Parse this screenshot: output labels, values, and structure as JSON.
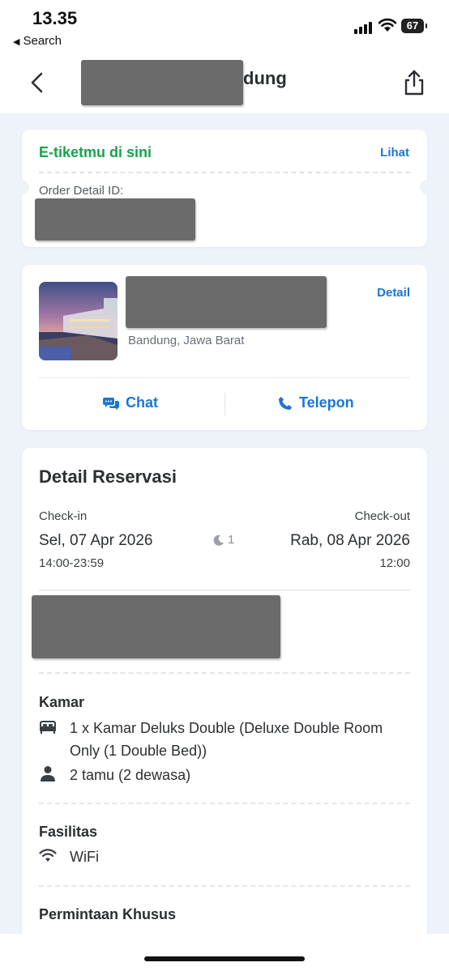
{
  "status_bar": {
    "time": "13.35",
    "back_app": "Search",
    "battery": "67"
  },
  "header": {
    "title_visible": "dung"
  },
  "eticket_card": {
    "title": "E-tiketmu di sini",
    "link": "Lihat",
    "order_label": "Order Detail ID:"
  },
  "hotel_card": {
    "location": "Bandung, Jawa Barat",
    "detail_link": "Detail",
    "chat_label": "Chat",
    "phone_label": "Telepon"
  },
  "reservation": {
    "title": "Detail Reservasi",
    "checkin_label": "Check-in",
    "checkout_label": "Check-out",
    "checkin_date": "Sel, 07 Apr 2026",
    "checkout_date": "Rab, 08 Apr 2026",
    "checkin_hours": "14:00-23:59",
    "checkout_hours": "12:00",
    "nights": "1",
    "room_heading": "Kamar",
    "room_desc": "1 x Kamar Deluks Double (Deluxe Double Room Only (1 Double Bed))",
    "guests": "2 tamu (2 dewasa)",
    "facilities_heading": "Fasilitas",
    "facility_wifi": "WiFi",
    "special_heading": "Permintaan Khusus"
  },
  "colors": {
    "accent": "#1a76d2",
    "success": "#17a34a",
    "background": "#eef2f9"
  }
}
